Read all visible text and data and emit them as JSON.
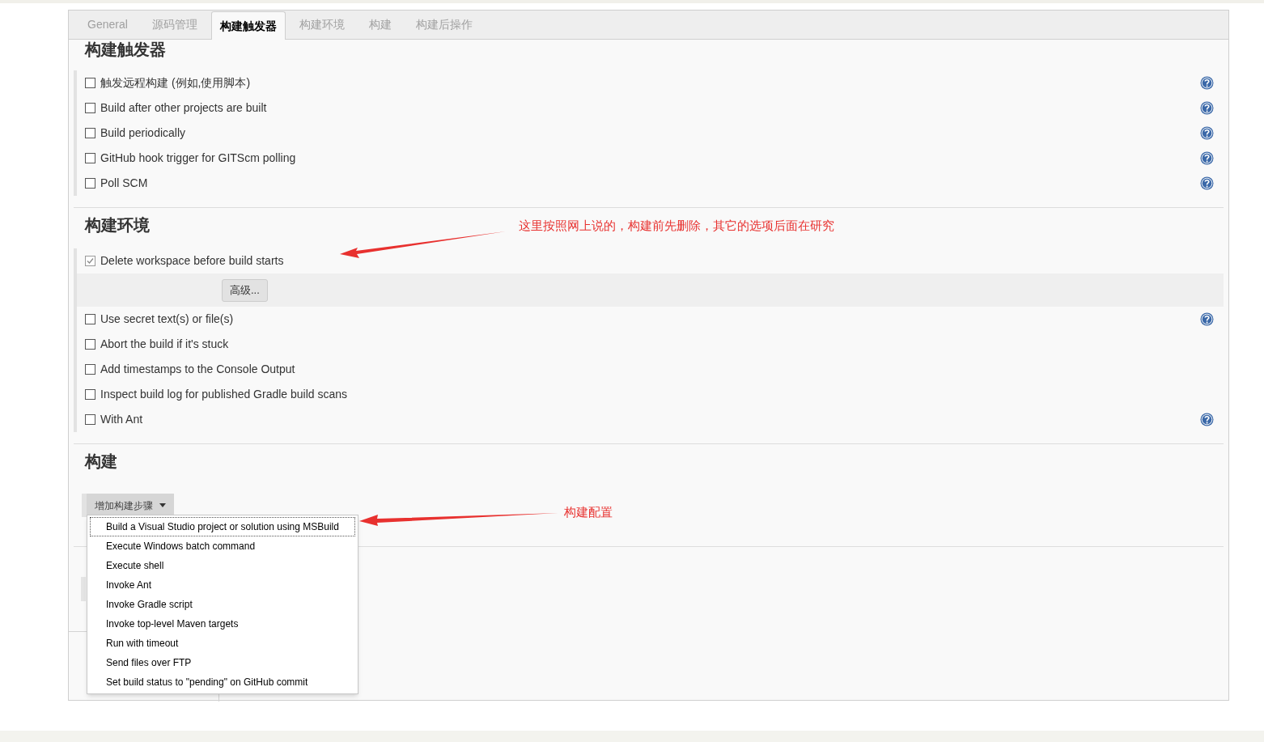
{
  "tabs": [
    {
      "label": "General",
      "selected": false
    },
    {
      "label": "源码管理",
      "selected": false
    },
    {
      "label": "构建触发器",
      "selected": true
    },
    {
      "label": "构建环境",
      "selected": false
    },
    {
      "label": "构建",
      "selected": false
    },
    {
      "label": "构建后操作",
      "selected": false
    }
  ],
  "sections": [
    {
      "title": "构建触发器",
      "options": [
        {
          "label": "触发远程构建 (例如,使用脚本)",
          "checked": false,
          "help": true
        },
        {
          "label": "Build after other projects are built",
          "checked": false,
          "help": true
        },
        {
          "label": "Build periodically",
          "checked": false,
          "help": true
        },
        {
          "label": "GitHub hook trigger for GITScm polling",
          "checked": false,
          "help": true
        },
        {
          "label": "Poll SCM",
          "checked": false,
          "help": true
        }
      ]
    },
    {
      "title": "构建环境",
      "options": [
        {
          "label": "Delete workspace before build starts",
          "checked": true,
          "help": false,
          "advanced_button": "高级..."
        },
        {
          "label": "Use secret text(s) or file(s)",
          "checked": false,
          "help": true
        },
        {
          "label": "Abort the build if it's stuck",
          "checked": false,
          "help": false
        },
        {
          "label": "Add timestamps to the Console Output",
          "checked": false,
          "help": false
        },
        {
          "label": "Inspect build log for published Gradle build scans",
          "checked": false,
          "help": false
        },
        {
          "label": "With Ant",
          "checked": false,
          "help": true
        }
      ]
    },
    {
      "title": "构建",
      "add_step_button": "增加构建步骤",
      "menu": [
        {
          "label": "Build a Visual Studio project or solution using MSBuild",
          "focused": true
        },
        {
          "label": "Execute Windows batch command",
          "focused": false
        },
        {
          "label": "Execute shell",
          "focused": false
        },
        {
          "label": "Invoke Ant",
          "focused": false
        },
        {
          "label": "Invoke Gradle script",
          "focused": false
        },
        {
          "label": "Invoke top-level Maven targets",
          "focused": false
        },
        {
          "label": "Run with timeout",
          "focused": false
        },
        {
          "label": "Send files over FTP",
          "focused": false
        },
        {
          "label": "Set build status to \"pending\" on GitHub commit",
          "focused": false
        }
      ]
    }
  ],
  "annotations": [
    {
      "text": "这里按照网上说的，构建前先删除，其它的选项后面在研究"
    },
    {
      "text": "构建配置"
    }
  ]
}
